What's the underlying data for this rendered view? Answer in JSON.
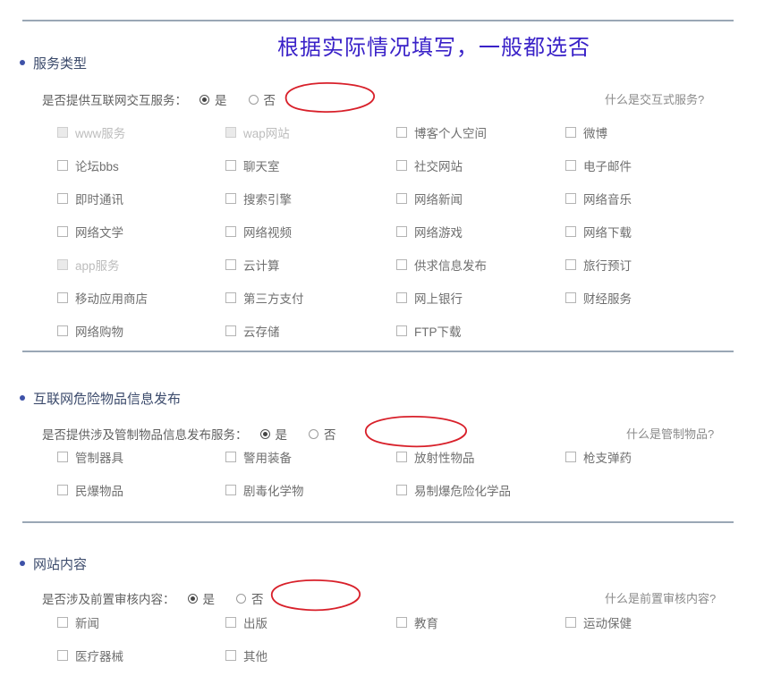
{
  "annotation": {
    "text": "根据实际情况填写，一般都选否",
    "color": "#3a22c8"
  },
  "theme": {
    "heading_color": "#3b4a6b",
    "bullet_color": "#3e52a8",
    "divider_color": "#9aa7b5",
    "ring_color": "#d8202a",
    "disabled_text": "#bdbdbd"
  },
  "radio_labels": {
    "yes": "是",
    "no": "否"
  },
  "sections": [
    {
      "title": "服务类型",
      "question": "是否提供互联网交互服务：",
      "selected": "是",
      "help": "什么是交互式服务?",
      "options": [
        {
          "label": "www服务",
          "disabled": true
        },
        {
          "label": "wap网站",
          "disabled": true
        },
        {
          "label": "博客个人空间",
          "disabled": false
        },
        {
          "label": "微博",
          "disabled": false
        },
        {
          "label": "论坛bbs",
          "disabled": false
        },
        {
          "label": "聊天室",
          "disabled": false
        },
        {
          "label": "社交网站",
          "disabled": false
        },
        {
          "label": "电子邮件",
          "disabled": false
        },
        {
          "label": "即时通讯",
          "disabled": false
        },
        {
          "label": "搜索引擎",
          "disabled": false
        },
        {
          "label": "网络新闻",
          "disabled": false
        },
        {
          "label": "网络音乐",
          "disabled": false
        },
        {
          "label": "网络文学",
          "disabled": false
        },
        {
          "label": "网络视频",
          "disabled": false
        },
        {
          "label": "网络游戏",
          "disabled": false
        },
        {
          "label": "网络下载",
          "disabled": false
        },
        {
          "label": "app服务",
          "disabled": true
        },
        {
          "label": "云计算",
          "disabled": false
        },
        {
          "label": "供求信息发布",
          "disabled": false
        },
        {
          "label": "旅行预订",
          "disabled": false
        },
        {
          "label": "移动应用商店",
          "disabled": false
        },
        {
          "label": "第三方支付",
          "disabled": false
        },
        {
          "label": "网上银行",
          "disabled": false
        },
        {
          "label": "财经服务",
          "disabled": false
        },
        {
          "label": "网络购物",
          "disabled": false
        },
        {
          "label": "云存储",
          "disabled": false
        },
        {
          "label": "FTP下载",
          "disabled": false
        }
      ]
    },
    {
      "title": "互联网危险物品信息发布",
      "question": "是否提供涉及管制物品信息发布服务：",
      "selected": "是",
      "help": "什么是管制物品?",
      "options": [
        {
          "label": "管制器具",
          "disabled": false
        },
        {
          "label": "警用装备",
          "disabled": false
        },
        {
          "label": "放射性物品",
          "disabled": false
        },
        {
          "label": "枪支弹药",
          "disabled": false
        },
        {
          "label": "民爆物品",
          "disabled": false
        },
        {
          "label": "剧毒化学物",
          "disabled": false
        },
        {
          "label": "易制爆危险化学品",
          "disabled": false
        }
      ]
    },
    {
      "title": "网站内容",
      "question": "是否涉及前置审核内容：",
      "selected": "是",
      "help": "什么是前置审核内容?",
      "options": [
        {
          "label": "新闻",
          "disabled": false
        },
        {
          "label": "出版",
          "disabled": false
        },
        {
          "label": "教育",
          "disabled": false
        },
        {
          "label": "运动保健",
          "disabled": false
        },
        {
          "label": "医疗器械",
          "disabled": false
        },
        {
          "label": "其他",
          "disabled": false
        }
      ]
    }
  ]
}
